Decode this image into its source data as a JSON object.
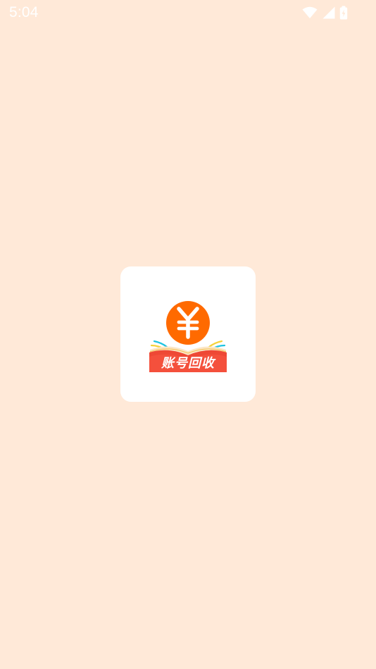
{
  "status_bar": {
    "time": "5:04",
    "icons": [
      "wifi-icon",
      "cellular-signal-icon",
      "battery-icon"
    ]
  },
  "splash": {
    "app_name": "账号回收",
    "logo_glyph": "¥",
    "logo_icon": "yen-coin-book-icon"
  },
  "colors": {
    "background": "#FFE9D8",
    "tile": "#FFFFFF",
    "coin": "#FF6A00",
    "banner": "#F4503C"
  }
}
